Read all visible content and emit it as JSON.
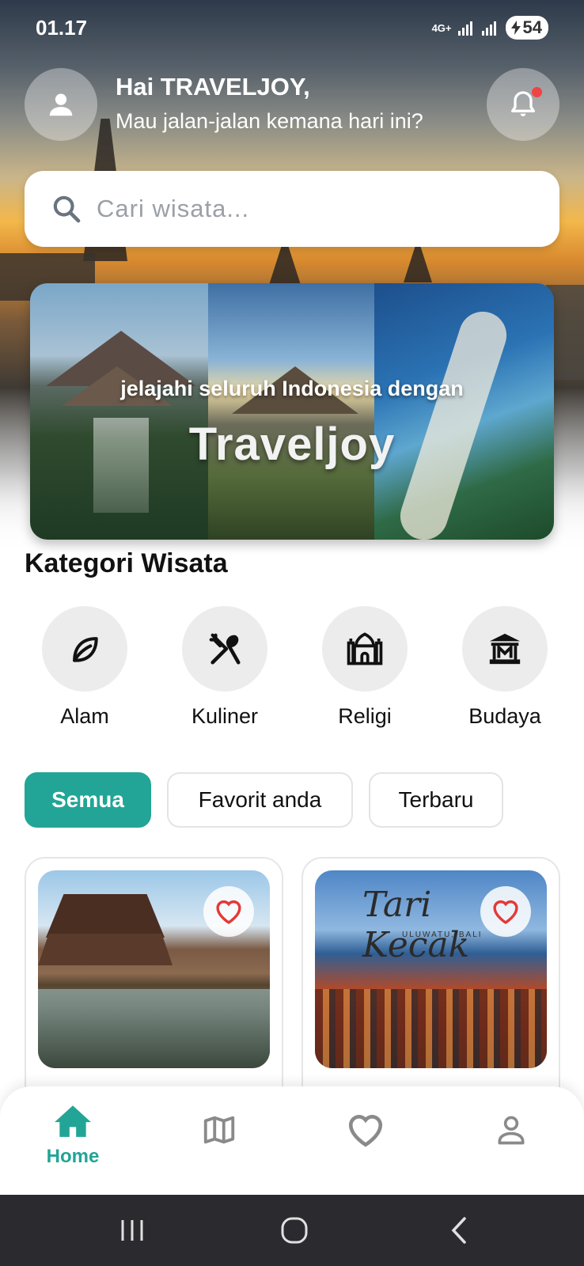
{
  "status_bar": {
    "time": "01.17",
    "network": "4G+",
    "battery": "54"
  },
  "header": {
    "greeting": "Hai TRAVELJOY,",
    "subtitle": "Mau jalan-jalan kemana hari ini?",
    "avatar_icon": "person-icon",
    "notification_icon": "bell-icon",
    "has_notification": true
  },
  "search": {
    "placeholder": "Cari wisata..."
  },
  "banner": {
    "subtitle": "jelajahi seluruh Indonesia dengan",
    "title": "Traveljoy"
  },
  "categories": {
    "title": "Kategori Wisata",
    "items": [
      {
        "label": "Alam",
        "icon": "leaf-icon"
      },
      {
        "label": "Kuliner",
        "icon": "fork-spoon-icon"
      },
      {
        "label": "Religi",
        "icon": "mosque-icon"
      },
      {
        "label": "Budaya",
        "icon": "museum-icon"
      }
    ]
  },
  "filters": {
    "items": [
      {
        "label": "Semua",
        "active": true
      },
      {
        "label": "Favorit anda",
        "active": false
      },
      {
        "label": "Terbaru",
        "active": false
      }
    ]
  },
  "cards": [
    {
      "image": "balinese-pavilion-pond",
      "favorite_icon": "heart-icon"
    },
    {
      "image": "tari-kecak-performance",
      "image_text": "Tari Kecak",
      "image_subtext": "ULUWATU, BALI",
      "favorite_icon": "heart-icon"
    }
  ],
  "bottom_nav": {
    "items": [
      {
        "label": "Home",
        "icon": "home-icon",
        "active": true
      },
      {
        "label": "",
        "icon": "map-icon",
        "active": false
      },
      {
        "label": "",
        "icon": "heart-icon",
        "active": false
      },
      {
        "label": "",
        "icon": "profile-icon",
        "active": false
      }
    ]
  },
  "colors": {
    "accent": "#22a596",
    "notification_dot": "#ef4444",
    "inactive_icon": "#8a8a8a"
  }
}
